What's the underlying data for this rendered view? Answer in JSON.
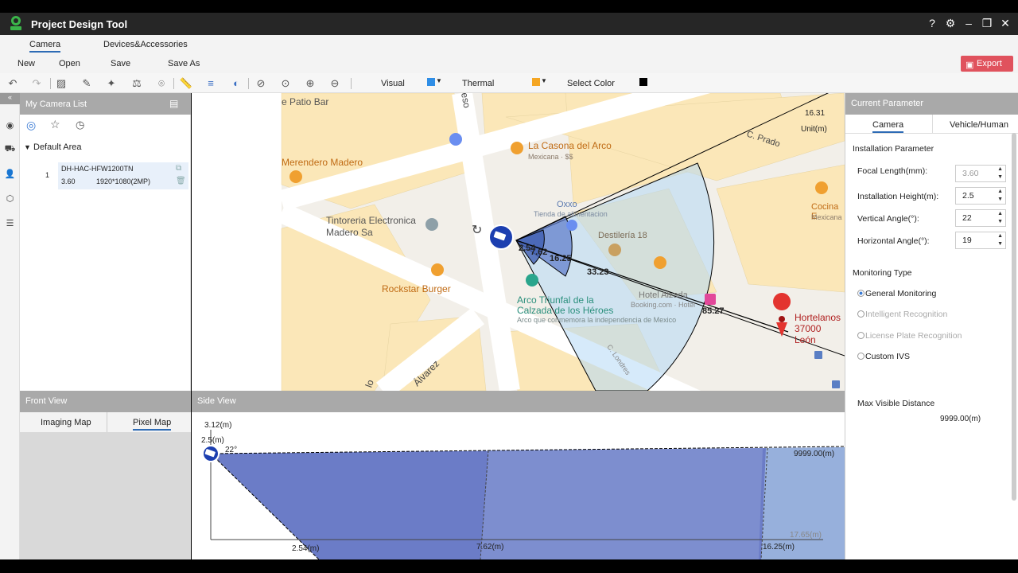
{
  "app": {
    "title": "Project Design Tool"
  },
  "window_controls": {
    "help": "?",
    "settings": "⚙",
    "minimize": "–",
    "restore": "❐",
    "close": "✕"
  },
  "tabs": [
    {
      "label": "Camera"
    },
    {
      "label": "Devices&Accessories"
    }
  ],
  "menu": {
    "new": "New",
    "open": "Open",
    "save": "Save",
    "save_as": "Save As",
    "export": "Export"
  },
  "toolbar": {
    "visual_label": "Visual",
    "thermal_label": "Thermal",
    "select_color_label": "Select Color",
    "colors": {
      "visual": "#2f8ee6",
      "thermal": "#f5a623",
      "select": "#000000"
    }
  },
  "camera_list": {
    "title": "My Camera List",
    "area": "Default Area",
    "items": [
      {
        "index": "1",
        "model": "DH-HAC-HFW1200TN",
        "focal": "3.60",
        "resolution": "1920*1080(2MP)"
      }
    ]
  },
  "map": {
    "scale_value": "16.31",
    "scale_unit": "Unit(m)",
    "labels": {
      "patio_bar": "e Patio Bar",
      "street_eso": "eso",
      "la_casona": "La Casona del Arco",
      "mexicana": "Mexicana · $$",
      "c_prado": "C. Prado",
      "merendero": "Merendero Madero",
      "tintoreria": "Tintoreria Electronica",
      "madero_sa": "Madero Sa",
      "oxxo": "Oxxo",
      "tienda": "Tienda de alimentacion",
      "destileria": "Destilería 18",
      "cocina": "Cocina E",
      "cocina2": "Mexicana",
      "rockstar": "Rockstar Burger",
      "arco": "Arco Triunfal de la",
      "calzada": "Calzada de los Héroes",
      "arco_desc": "Arco que conmemora la independencia de Mexico",
      "hotel": "Hotel Alzada",
      "booking": "Booking.com · Hotel",
      "hortelanos": "Hortelanos",
      "hortelanos_addr": "37000 León",
      "alvarez": "Álvarez",
      "street_lo": "lo",
      "londres": "C. Londres"
    },
    "distances": {
      "d1": "2.54",
      "d2": "7.62",
      "d3": "16.25",
      "d4": "33.23",
      "d5": "85.27"
    }
  },
  "front_view": {
    "title": "Front View",
    "tabs": [
      {
        "label": "Imaging Map"
      },
      {
        "label": "Pixel Map"
      }
    ]
  },
  "side_view": {
    "title": "Side View",
    "height_max": "3.12(m)",
    "install_height": "2.5(m)",
    "angle": "22°",
    "far_distance": "9999.00(m)",
    "d1": "2.54(m)",
    "d2": "7.62(m)",
    "d3": "16.25(m)",
    "d4": "17.65(m)"
  },
  "params": {
    "header": "Current Parameter",
    "tabs": [
      {
        "label": "Camera"
      },
      {
        "label": "Vehicle/Human"
      }
    ],
    "installation_title": "Installation Parameter",
    "fields": [
      {
        "label": "Focal Length(mm):",
        "value": "3.60"
      },
      {
        "label": "Installation Height(m):",
        "value": "2.5"
      },
      {
        "label": "Vertical Angle(°):",
        "value": "22"
      },
      {
        "label": "Horizontal Angle(°):",
        "value": "19"
      }
    ],
    "monitoring_title": "Monitoring Type",
    "monitoring_options": [
      {
        "label": "General Monitoring"
      },
      {
        "label": "Intelligent Recognition"
      },
      {
        "label": "License Plate Recognition"
      },
      {
        "label": "Custom IVS"
      }
    ],
    "max_visible_title": "Max Visible Distance",
    "max_visible_value": "9999.00(m)"
  }
}
